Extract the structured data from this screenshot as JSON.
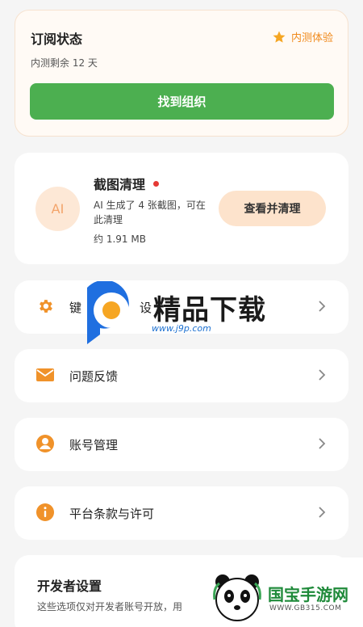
{
  "subscription": {
    "title": "订阅状态",
    "badge": "内测体验",
    "remaining": "内测剩余 12 天",
    "button": "找到组织",
    "accent_color": "#f08a1c",
    "button_color": "#4caf50"
  },
  "cleanup": {
    "avatar": "AI",
    "title": "截图清理",
    "description": "AI 生成了 4 张截图，可在此清理",
    "size": "约 1.91 MB",
    "button": "查看并清理"
  },
  "menu": [
    {
      "label": "键",
      "icon": "gear-icon"
    },
    {
      "label": "问题反馈",
      "icon": "mail-icon"
    },
    {
      "label": "账号管理",
      "icon": "account-icon"
    },
    {
      "label": "平台条款与许可",
      "icon": "info-icon"
    }
  ],
  "menu_row1_partial": "设",
  "developer": {
    "title": "开发者设置",
    "description": "这些选项仅对开发者账号开放，用"
  },
  "watermark": {
    "title": "精品下载",
    "url": "www.j9p.com",
    "corner_title": "国宝手游网",
    "corner_url": "WWW.GB315.COM"
  }
}
